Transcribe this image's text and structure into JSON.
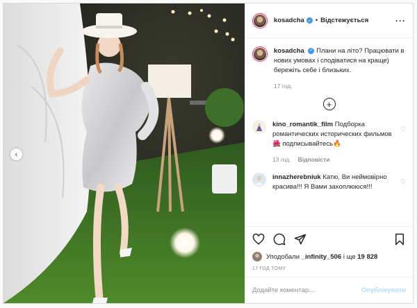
{
  "post": {
    "author": {
      "username": "kosadcha",
      "verified": true,
      "follow_state": "Відстежується"
    },
    "caption": {
      "username": "kosadcha",
      "text": "Плани на літо? Працювати в нових умовах і сподіватися на краще) бережіть себе і близьких.",
      "time": "17 год."
    },
    "comments": [
      {
        "username": "kino_romantik_film",
        "text": "Подборка романтических исторических фильмов🌺 подписывайтесь🔥",
        "time": "13 год.",
        "reply_label": "Відповісти"
      },
      {
        "username": "innazherebniuk",
        "text": "Катю, Ви неймовірно красива!!! Я Вами захоплююся!!!",
        "time": "",
        "reply_label": ""
      }
    ],
    "likes": {
      "prefix": "Уподобали",
      "first_user": "_infinity_506",
      "connector": "і ще",
      "count": "19 828"
    },
    "timestamp": "17 ГОД ТОМУ",
    "add_comment": {
      "placeholder": "Додайте коментар...",
      "publish_label": "Опублікувати"
    },
    "icons": {
      "more": "more-horizontal-icon",
      "like": "heart-icon",
      "comment": "comment-icon",
      "share": "share-icon",
      "save": "bookmark-icon",
      "load_more": "plus-circle-icon",
      "carousel_prev": "chevron-left-icon"
    },
    "colors": {
      "verified": "#3897f0",
      "publish_disabled": "#b2dffc",
      "story_ring": "#e1306c",
      "muted": "#8e8e8e"
    }
  }
}
